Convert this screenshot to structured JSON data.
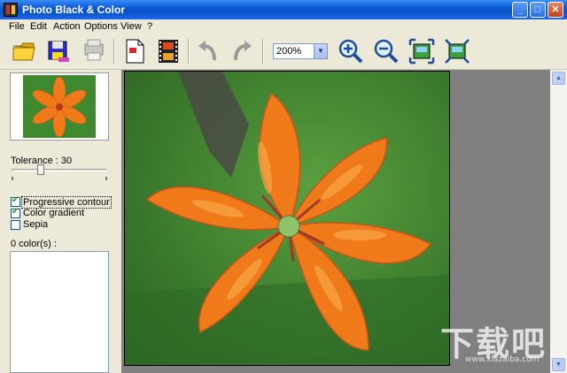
{
  "window": {
    "title": "Photo Black & Color"
  },
  "menu": [
    "File",
    "Edit",
    "Action",
    "Options",
    "View",
    "?"
  ],
  "toolbar": {
    "zoom_value": "200%",
    "buttons": [
      "open-folder",
      "save-disk",
      "print",
      "document",
      "film",
      "undo",
      "redo",
      "zoom-in",
      "zoom-out",
      "fit-window",
      "actual-size"
    ]
  },
  "left_panel": {
    "tolerance_label": "Tolerance : 30",
    "tolerance_value": 30,
    "checkboxes": [
      {
        "label": "Progressive contour",
        "checked": true
      },
      {
        "label": "Color gradient",
        "checked": true
      },
      {
        "label": "Sepia",
        "checked": false
      }
    ],
    "colors_label": "0 color(s) :"
  },
  "watermark": {
    "big": "下载吧",
    "small": "www.xiazaiba.com"
  },
  "colors": {
    "title_bar": "#0a5ad8",
    "flower": "#f07a1a",
    "canvas_bg": "#808080"
  }
}
